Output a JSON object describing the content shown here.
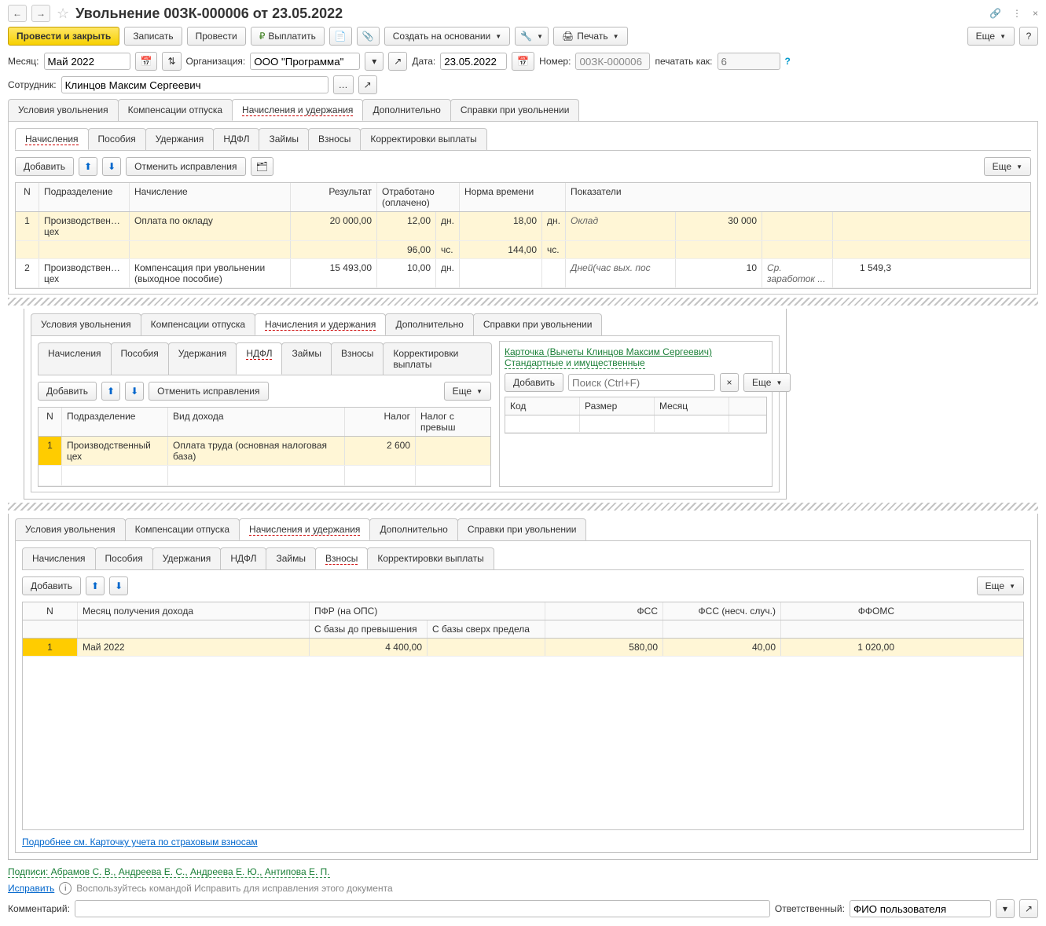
{
  "title": "Увольнение 00ЗК-000006 от 23.05.2022",
  "titleIcons": {
    "back": "←",
    "fwd": "→",
    "star": "☆",
    "link": "🔗",
    "menu": "⋮",
    "close": "×"
  },
  "toolbar": {
    "post_close": "Провести и закрыть",
    "save": "Записать",
    "post": "Провести",
    "pay": "Выплатить",
    "create_based": "Создать на основании",
    "print": "Печать",
    "more": "Еще",
    "help": "?"
  },
  "fields": {
    "month_lbl": "Месяц:",
    "month": "Май 2022",
    "org_lbl": "Организация:",
    "org": "ООО \"Программа\"",
    "date_lbl": "Дата:",
    "date": "23.05.2022",
    "num_lbl": "Номер:",
    "num": "00ЗК-000006",
    "printas_lbl": "печатать как:",
    "printas": "6",
    "emp_lbl": "Сотрудник:",
    "emp": "Клинцов Максим Сергеевич"
  },
  "mainTabs": [
    "Условия увольнения",
    "Компенсации отпуска",
    "Начисления и удержания",
    "Дополнительно",
    "Справки при увольнении"
  ],
  "subTabs1": [
    "Начисления",
    "Пособия",
    "Удержания",
    "НДФЛ",
    "Займы",
    "Взносы",
    "Корректировки выплаты"
  ],
  "subbar": {
    "add": "Добавить",
    "cancel": "Отменить исправления",
    "more": "Еще"
  },
  "grid1": {
    "headers": {
      "n": "N",
      "dept": "Подразделение",
      "accr": "Начисление",
      "res": "Результат",
      "worked": "Отработано (оплачено)",
      "norm": "Норма времени",
      "ind": "Показатели"
    },
    "rows": [
      {
        "n": "1",
        "dept": "Производственный цех",
        "accr": "Оплата по окладу",
        "res": "20 000,00",
        "w1": "12,00",
        "w1u": "дн.",
        "n1": "18,00",
        "n1u": "дн.",
        "ind": "Оклад",
        "indv": "30 000",
        "w2": "96,00",
        "w2u": "чс.",
        "n2": "144,00",
        "n2u": "чс."
      },
      {
        "n": "2",
        "dept": "Производственный цех",
        "accr": "Компенсация при увольнении (выходное пособие)",
        "res": "15 493,00",
        "w1": "10,00",
        "w1u": "дн.",
        "ind": "Дней(час вых. пос",
        "indv": "10",
        "ex1": "Ср. заработок ...",
        "ex2": "1 549,3"
      }
    ]
  },
  "block2": {
    "tabActive": "НДФЛ",
    "grid": {
      "headers": {
        "n": "N",
        "dept": "Подразделение",
        "inc": "Вид дохода",
        "tax": "Налог",
        "taxex": "Налог с превыш"
      },
      "row": {
        "n": "1",
        "dept": "Производственный цех",
        "inc": "Оплата труда (основная налоговая база)",
        "tax": "2 600"
      }
    },
    "card": {
      "title": "Карточка (Вычеты Клинцов Максим Сергеевич)",
      "stdlink": "Стандартные и имущественные",
      "add": "Добавить",
      "search_ph": "Поиск (Ctrl+F)",
      "more": "Еще",
      "cols": {
        "code": "Код",
        "size": "Размер",
        "month": "Месяц"
      }
    }
  },
  "block3": {
    "tabActive": "Взносы",
    "headers": {
      "n": "N",
      "month": "Месяц получения дохода",
      "pfr": "ПФР (на ОПС)",
      "pfr1": "С базы до превышения",
      "pfr2": "С базы сверх предела",
      "fss": "ФСС",
      "fssn": "ФСС (несч. случ.)",
      "ffoms": "ФФОМС"
    },
    "row": {
      "n": "1",
      "month": "Май 2022",
      "pfr1": "4 400,00",
      "fss": "580,00",
      "fssn": "40,00",
      "ffoms": "1 020,00"
    },
    "detailLink": "Подробнее см. Карточку учета по страховым взносам"
  },
  "footer": {
    "signs": "Подписи: Абрамов С. В., Андреева Е. С., Андреева Е. Ю., Антипова Е. П.",
    "fix": "Исправить",
    "fixhint": "Воспользуйтесь командой Исправить для исправления этого документа",
    "comment_lbl": "Комментарий:",
    "resp_lbl": "Ответственный:",
    "resp": "ФИО пользователя"
  }
}
